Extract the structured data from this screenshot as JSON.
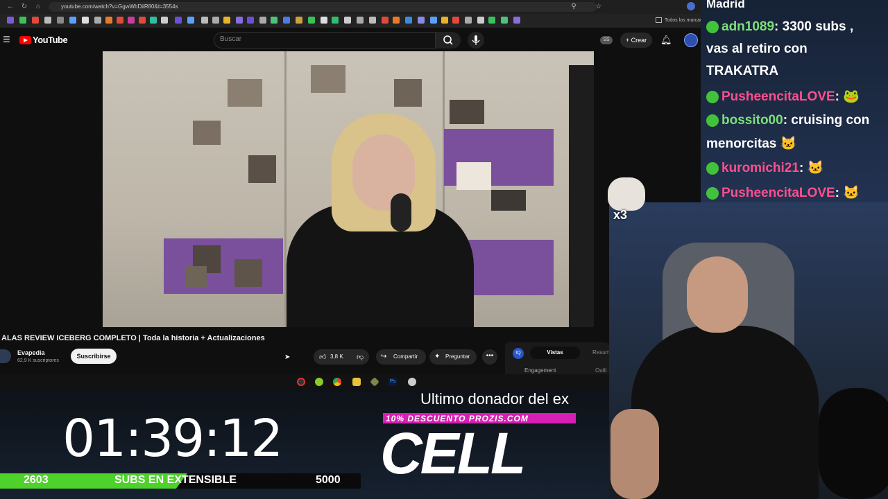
{
  "browser": {
    "url": "youtube.com/watch?v=GgwWbDiiR80&t=3554s",
    "bookmarks_label": "Todos los marcador"
  },
  "youtube": {
    "logo_text": "YouTube",
    "search_placeholder": "Buscar",
    "badge": "SS",
    "create_label": "Crear",
    "video_title": "ALAS REVIEW ICEBERG COMPLETO | Toda la historia + Actualizaciones",
    "channel_name": "Evapedia",
    "channel_subs": "62,9 K suscriptores",
    "subscribe_label": "Suscribirse",
    "likes": "3,8 K",
    "share_label": "Compartir",
    "ask_label": "Preguntar",
    "more_label": "•••",
    "panel": {
      "tab_active": "Vistas",
      "tab_other": "Resum",
      "metric_left": "Engagement",
      "metric_right": "Outli"
    }
  },
  "overlay": {
    "timer": "01:39:12",
    "subs_current": "2603",
    "subs_label": "SUBS EN EXTENSIBLE",
    "subs_goal": "5000",
    "donor_text": "Ultimo donador del ex",
    "promo_text": "10% DESCUENTO PROZIS.COM",
    "donor_name": "CELL"
  },
  "chat": {
    "top_partial": "Madrid",
    "messages": [
      {
        "user": "adn1089",
        "text": ": 3300 subs ,",
        "color": "green"
      },
      {
        "user": "",
        "text": "vas al retiro con",
        "color": "none"
      },
      {
        "user": "",
        "text": "TRAKATRA",
        "color": "none"
      },
      {
        "user": "PusheencitaLOVE",
        "text": ":",
        "color": "pink"
      },
      {
        "user": "bossito00",
        "text": ": cruising con",
        "color": "green"
      },
      {
        "user": "",
        "text": "menorcitas",
        "color": "none"
      },
      {
        "user": "kuromichi21",
        "text": ":",
        "color": "pink"
      },
      {
        "user": "PusheencitaLOVE",
        "text": ":",
        "color": "pink"
      }
    ]
  },
  "emote": {
    "multiplier": "x3"
  },
  "colors": {
    "yt_red": "#ff0000",
    "progress_green": "#4ed12a",
    "promo_magenta": "#d61fb3",
    "chat_user_green": "#7de07a",
    "chat_user_pink": "#ff4f8f"
  },
  "progress": {
    "subs_fraction": 0.52
  }
}
